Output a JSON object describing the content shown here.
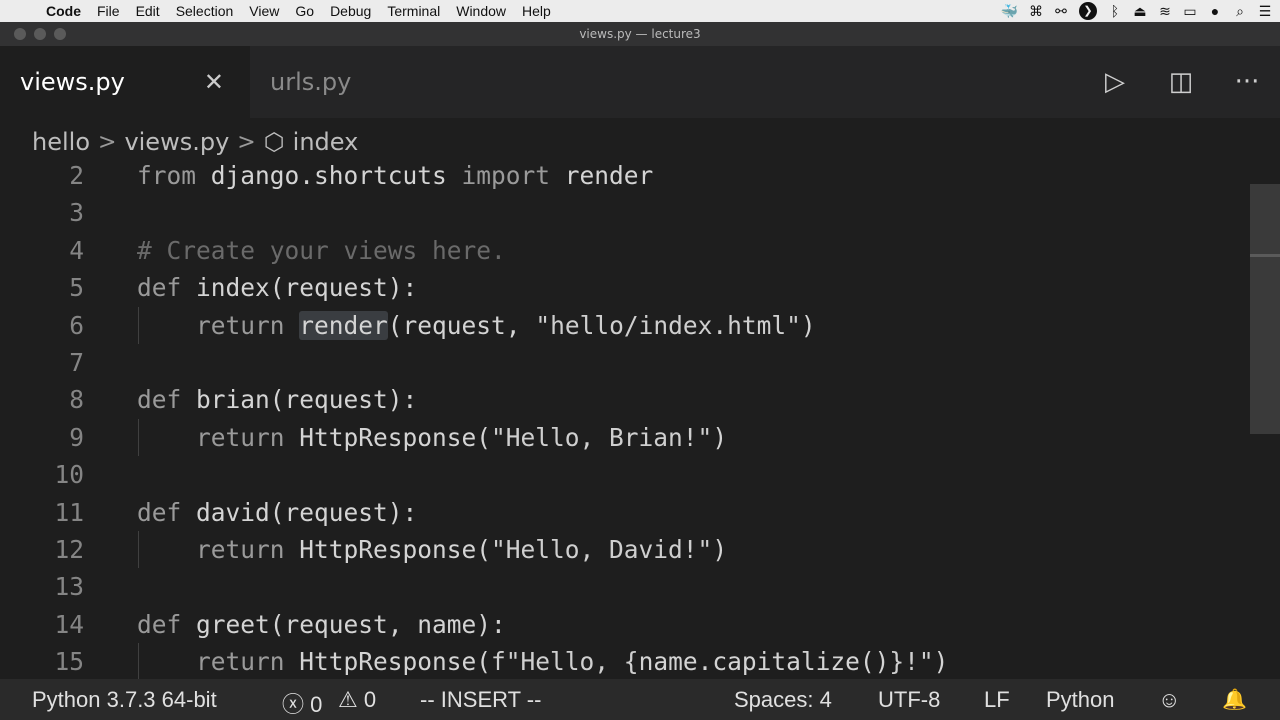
{
  "menubar": {
    "apple_icon": "",
    "items": [
      "Code",
      "File",
      "Edit",
      "Selection",
      "View",
      "Go",
      "Debug",
      "Terminal",
      "Window",
      "Help"
    ],
    "status_icons": [
      "docker-icon",
      "command-icon",
      "glasses-icon",
      "circle-arrow-icon",
      "bluetooth-icon",
      "eject-icon",
      "wifi-icon",
      "battery-icon",
      "user-icon",
      "search-icon",
      "list-icon"
    ]
  },
  "window": {
    "title": "views.py — lecture3"
  },
  "tabs": [
    {
      "label": "views.py",
      "close": "✕"
    },
    {
      "label": "urls.py"
    }
  ],
  "editor_actions": {
    "run": "▷",
    "split": "◫",
    "more": "···"
  },
  "breadcrumb": {
    "folder": "hello",
    "file": "views.py",
    "symbol_icon": "⬡",
    "symbol": "index",
    "separator": ">"
  },
  "code": [
    {
      "n": "2",
      "parts": [
        [
          "kw",
          "from "
        ],
        [
          "",
          "django.shortcuts "
        ],
        [
          "kw",
          "import "
        ],
        [
          "",
          "render"
        ]
      ]
    },
    {
      "n": "3",
      "parts": []
    },
    {
      "n": "4",
      "parts": [
        [
          "cm",
          "# Create your views here."
        ]
      ]
    },
    {
      "n": "5",
      "parts": [
        [
          "kw",
          "def "
        ],
        [
          "",
          "index(request):"
        ]
      ]
    },
    {
      "n": "6",
      "guide": true,
      "parts": [
        [
          "",
          "    "
        ],
        [
          "kw",
          "return "
        ],
        [
          "hl",
          "render"
        ],
        [
          "",
          "(request, "
        ],
        [
          "st",
          "\"hello/index.html\""
        ],
        [
          "",
          ")"
        ]
      ]
    },
    {
      "n": "7",
      "parts": []
    },
    {
      "n": "8",
      "parts": [
        [
          "kw",
          "def "
        ],
        [
          "",
          "brian(request):"
        ]
      ]
    },
    {
      "n": "9",
      "guide": true,
      "parts": [
        [
          "",
          "    "
        ],
        [
          "kw",
          "return "
        ],
        [
          "",
          "HttpResponse("
        ],
        [
          "st",
          "\"Hello, Brian!\""
        ],
        [
          "",
          ")"
        ]
      ]
    },
    {
      "n": "10",
      "parts": []
    },
    {
      "n": "11",
      "parts": [
        [
          "kw",
          "def "
        ],
        [
          "",
          "david(request):"
        ]
      ]
    },
    {
      "n": "12",
      "guide": true,
      "parts": [
        [
          "",
          "    "
        ],
        [
          "kw",
          "return "
        ],
        [
          "",
          "HttpResponse("
        ],
        [
          "st",
          "\"Hello, David!\""
        ],
        [
          "",
          ")"
        ]
      ]
    },
    {
      "n": "13",
      "parts": []
    },
    {
      "n": "14",
      "parts": [
        [
          "kw",
          "def "
        ],
        [
          "",
          "greet(request, name):"
        ]
      ]
    },
    {
      "n": "15",
      "guide": true,
      "parts": [
        [
          "",
          "    "
        ],
        [
          "kw",
          "return "
        ],
        [
          "",
          "HttpResponse("
        ],
        [
          "st",
          "f\"Hello, {"
        ],
        [
          "",
          "name.capitalize()"
        ],
        [
          "st",
          "}!\""
        ],
        [
          "",
          ")"
        ]
      ]
    }
  ],
  "statusbar": {
    "interpreter": "Python 3.7.3 64-bit",
    "errors": "ⓧ 0",
    "warnings": "⚠ 0",
    "mode": "-- INSERT --",
    "spaces": "Spaces: 4",
    "encoding": "UTF-8",
    "eol": "LF",
    "language": "Python",
    "feedback_icon": "☺",
    "bell_icon": "🔔"
  }
}
